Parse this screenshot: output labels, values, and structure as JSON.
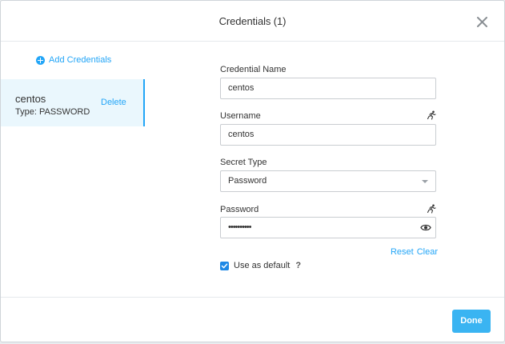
{
  "dialog": {
    "title": "Credentials (1)",
    "close_icon": "close-icon"
  },
  "sidebar": {
    "add_label": "Add Credentials",
    "add_icon": "plus-circle-icon",
    "items": [
      {
        "name": "centos",
        "type": "Type: PASSWORD",
        "delete_label": "Delete"
      }
    ]
  },
  "form": {
    "credential_name": {
      "label": "Credential Name",
      "value": "centos"
    },
    "username": {
      "label": "Username",
      "value": "centos",
      "icon": "runtime-variable-icon"
    },
    "secret_type": {
      "label": "Secret Type",
      "value": "Password",
      "icon": "chevron-down-icon"
    },
    "password": {
      "label": "Password",
      "value": "••••••••••",
      "icon": "runtime-variable-icon",
      "reveal_icon": "eye-icon"
    },
    "reset_label": "Reset",
    "clear_label": "Clear",
    "use_default": {
      "label": "Use as default",
      "checked": true,
      "help": "?"
    }
  },
  "footer": {
    "done_label": "Done"
  },
  "colors": {
    "accent": "#22a5f7",
    "done_button": "#3ab4f2",
    "selected_bg": "#eaf7fd",
    "checkbox": "#1e88e5"
  }
}
